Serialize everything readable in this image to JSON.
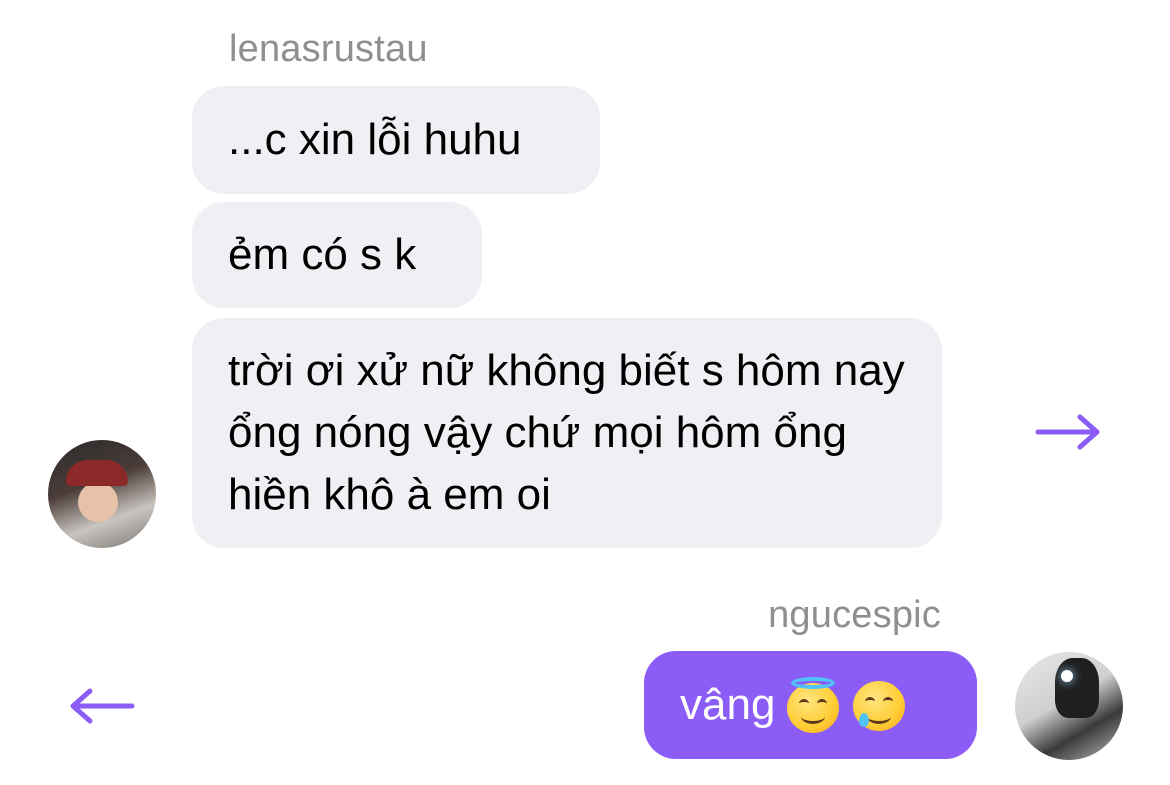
{
  "chat": {
    "incoming": {
      "sender": "lenasrustau",
      "messages": [
        "...c xin lỗi huhu",
        "ẻm có s k",
        "trời ơi xử nữ không biết s hôm nay ổng nóng vậy chứ mọi hôm ổng hiền khô à em oi"
      ]
    },
    "outgoing": {
      "sender": "ngucespic",
      "messages": [
        "vâng"
      ],
      "emojis": [
        "smiling-face-with-halo",
        "smiling-face-with-tear"
      ]
    }
  },
  "navigation": {
    "next_icon": "arrow-right-icon",
    "prev_icon": "arrow-left-icon"
  },
  "colors": {
    "accent": "#8b5cf6",
    "incoming_bubble": "#efeff4",
    "sender_name": "#8e8e93"
  }
}
